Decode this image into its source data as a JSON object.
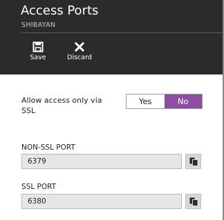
{
  "blade": {
    "title": "Access Ports",
    "subtitle": "SHIBAYAN"
  },
  "commands": {
    "save_label": "Save",
    "discard_label": "Discard"
  },
  "ssl_setting": {
    "label": "Allow access only via SSL",
    "options": [
      "Yes",
      "No"
    ],
    "selected": "No"
  },
  "ports": {
    "non_ssl": {
      "label": "NON-SSL PORT",
      "value": "6379"
    },
    "ssl": {
      "label": "SSL PORT",
      "value": "6380"
    }
  },
  "colors": {
    "header_bg": "#2b2b2b",
    "accent": "#8b4ea3"
  },
  "icons": {
    "save": "save-icon",
    "discard": "close-icon",
    "copy": "copy-icon"
  }
}
